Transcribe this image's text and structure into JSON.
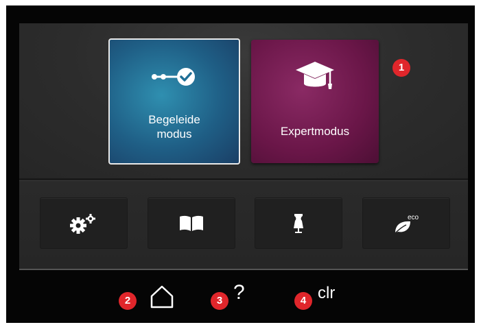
{
  "tiles": {
    "guided": {
      "label_line1": "Begeleide",
      "label_line2": "modus",
      "icon": "guided-steps-icon"
    },
    "expert": {
      "label": "Expertmodus",
      "icon": "graduation-cap-icon"
    }
  },
  "function_buttons": [
    {
      "icon": "settings-gears-icon"
    },
    {
      "icon": "book-icon"
    },
    {
      "icon": "dress-form-icon"
    },
    {
      "icon": "eco-leaf-icon",
      "icon_text": "eco"
    }
  ],
  "bottom_bar": {
    "help_label": "?",
    "clear_label": "clr"
  },
  "callouts": [
    "1",
    "2",
    "3",
    "4"
  ],
  "colors": {
    "guided_tile": "#1f5f86",
    "expert_tile": "#6a1648",
    "callout": "#e0262b",
    "background": "#050505"
  }
}
